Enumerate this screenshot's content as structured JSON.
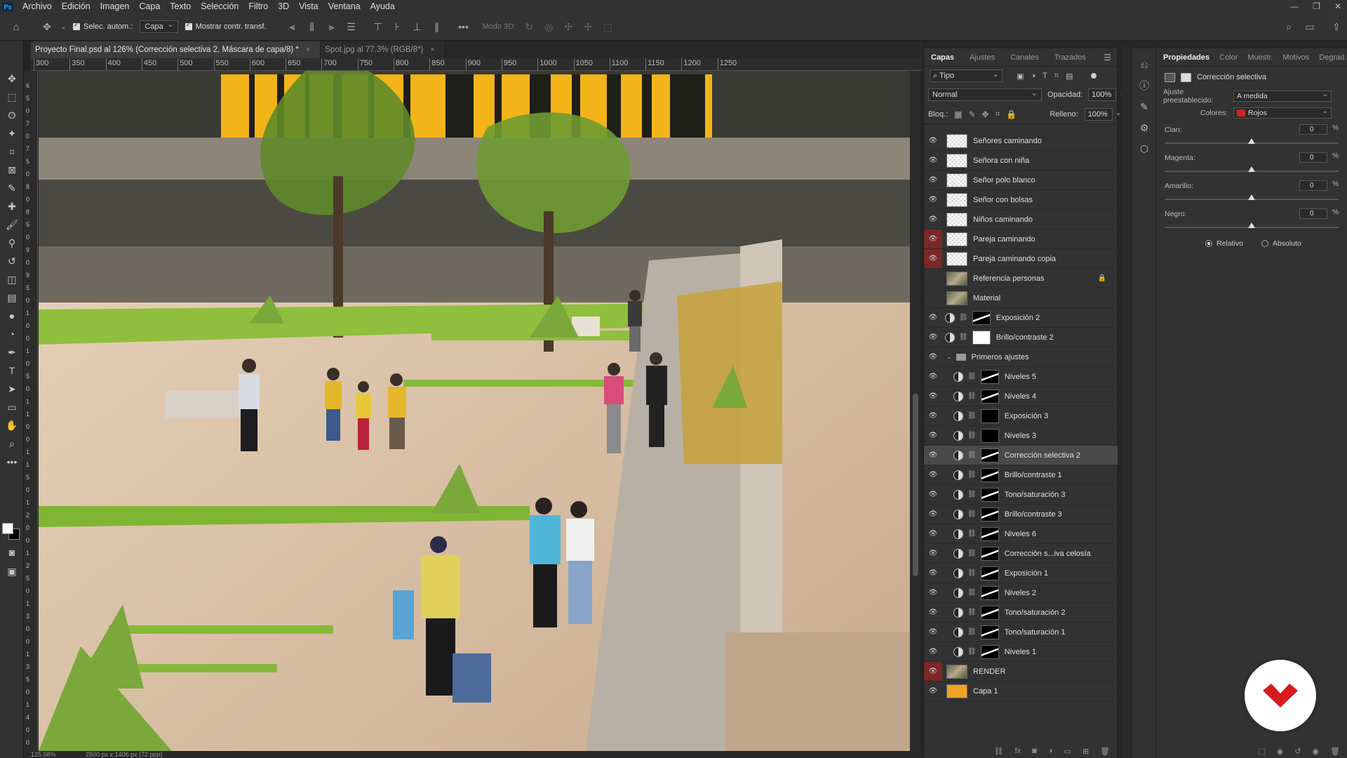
{
  "menubar": {
    "logo": "Ps",
    "items": [
      "Archivo",
      "Edición",
      "Imagen",
      "Capa",
      "Texto",
      "Selección",
      "Filtro",
      "3D",
      "Vista",
      "Ventana",
      "Ayuda"
    ]
  },
  "options": {
    "auto_select_label": "Selec. autom.:",
    "auto_select_target": "Capa",
    "show_transform_label": "Mostrar contr. transf.",
    "mode3d_label": "Modo 3D:"
  },
  "doc_tabs": [
    {
      "label": "Proyecto Final.psd al 126% (Corrección selectiva 2, Máscara de capa/8) *",
      "active": true
    },
    {
      "label": "Spot.jpg al 77.3% (RGB/8*)",
      "active": false
    }
  ],
  "ruler_top": [
    "300",
    "350",
    "400",
    "450",
    "500",
    "550",
    "600",
    "650",
    "700",
    "750",
    "800",
    "850",
    "900",
    "950",
    "1000",
    "1050",
    "1100",
    "1150",
    "1200",
    "1250"
  ],
  "ruler_left": [
    "6",
    "5",
    "0",
    "7",
    "0",
    "7",
    "5",
    "0",
    "8",
    "0",
    "8",
    "5",
    "0",
    "9",
    "0",
    "9",
    "5",
    "0",
    "1",
    "0",
    "0",
    "1",
    "0",
    "5",
    "0",
    "1",
    "1",
    "0",
    "0",
    "1",
    "1",
    "5",
    "0",
    "1",
    "2",
    "0",
    "0",
    "1",
    "2",
    "5",
    "0",
    "1",
    "3",
    "0",
    "0",
    "1",
    "3",
    "5",
    "0",
    "1",
    "4",
    "0",
    "0"
  ],
  "status": {
    "zoom": "125.58%",
    "doc_info": "2500 px x 1406 px (72 ppp)"
  },
  "layers_panel": {
    "tabs": [
      "Capas",
      "Ajustes",
      "Canales",
      "Trazados"
    ],
    "filter_label": "Tipo",
    "blend_mode": "Normal",
    "opacity_label": "Opacidad:",
    "opacity_value": "100%",
    "lock_label": "Bloq.:",
    "fill_label": "Relleno:",
    "fill_value": "100%",
    "layers": [
      {
        "name": "Señores caminando",
        "thumb": "checker",
        "eye": "on",
        "kind": "pixel"
      },
      {
        "name": "Señora con niña",
        "thumb": "checker",
        "eye": "on",
        "kind": "pixel"
      },
      {
        "name": "Señor polo blanco",
        "thumb": "checker",
        "eye": "on",
        "kind": "pixel"
      },
      {
        "name": "Señor con bolsas",
        "thumb": "checker",
        "eye": "on",
        "kind": "pixel"
      },
      {
        "name": "Niños caminando",
        "thumb": "checker",
        "eye": "on",
        "kind": "pixel"
      },
      {
        "name": "Pareja caminando",
        "thumb": "checker",
        "eye": "red",
        "kind": "pixel"
      },
      {
        "name": "Pareja caminando copia",
        "thumb": "checker",
        "eye": "red",
        "kind": "pixel"
      },
      {
        "name": "Referencia personas",
        "thumb": "photo",
        "eye": "off",
        "kind": "pixel",
        "locked": true
      },
      {
        "name": "Material",
        "thumb": "photo",
        "eye": "off",
        "kind": "pixel"
      },
      {
        "name": "Exposición 2",
        "thumb": "mask-mixed",
        "eye": "on",
        "kind": "adj"
      },
      {
        "name": "Brillo/contraste 2",
        "thumb": "mask-white",
        "eye": "on",
        "kind": "adj"
      },
      {
        "name": "Primeros ajustes",
        "eye": "on",
        "kind": "group"
      },
      {
        "name": "Niveles 5",
        "thumb": "mask-mixed",
        "eye": "on",
        "kind": "adj",
        "indent": true
      },
      {
        "name": "Niveles 4",
        "thumb": "mask-mixed",
        "eye": "on",
        "kind": "adj",
        "indent": true
      },
      {
        "name": "Exposición 3",
        "thumb": "mask-black",
        "eye": "on",
        "kind": "adj",
        "indent": true
      },
      {
        "name": "Niveles 3",
        "thumb": "mask-black",
        "eye": "on",
        "kind": "adj",
        "indent": true
      },
      {
        "name": "Corrección selectiva 2",
        "thumb": "mask-mixed",
        "eye": "on",
        "kind": "adj",
        "indent": true,
        "selected": true
      },
      {
        "name": "Brillo/contraste 1",
        "thumb": "mask-mixed",
        "eye": "on",
        "kind": "adj",
        "indent": true
      },
      {
        "name": "Tono/saturación 3",
        "thumb": "mask-mixed",
        "eye": "on",
        "kind": "adj",
        "indent": true
      },
      {
        "name": "Brillo/contraste 3",
        "thumb": "mask-mixed",
        "eye": "on",
        "kind": "adj",
        "indent": true
      },
      {
        "name": "Niveles 6",
        "thumb": "mask-mixed",
        "eye": "on",
        "kind": "adj",
        "indent": true
      },
      {
        "name": "Corrección s...iva celosía",
        "thumb": "mask-mixed",
        "eye": "on",
        "kind": "adj",
        "indent": true
      },
      {
        "name": "Exposición 1",
        "thumb": "mask-mixed",
        "eye": "on",
        "kind": "adj",
        "indent": true
      },
      {
        "name": "Niveles 2",
        "thumb": "mask-mixed",
        "eye": "on",
        "kind": "adj",
        "indent": true
      },
      {
        "name": "Tono/saturación 2",
        "thumb": "mask-mixed",
        "eye": "on",
        "kind": "adj",
        "indent": true
      },
      {
        "name": "Tono/saturación 1",
        "thumb": "mask-mixed",
        "eye": "on",
        "kind": "adj",
        "indent": true
      },
      {
        "name": "Niveles 1",
        "thumb": "mask-mixed",
        "eye": "on",
        "kind": "adj",
        "indent": true
      },
      {
        "name": "RENDER",
        "thumb": "photo",
        "eye": "red",
        "kind": "pixel"
      },
      {
        "name": "Capa 1",
        "thumb": "orange",
        "eye": "on",
        "kind": "pixel"
      }
    ]
  },
  "properties_panel": {
    "tabs": [
      "Propiedades",
      "Color",
      "Muestr.",
      "Motivos",
      "Degrad."
    ],
    "header": "Corrección selectiva",
    "preset_label": "Ajuste preestablecido:",
    "preset_value": "A medida",
    "colors_label": "Colores:",
    "colors_value": "Rojos",
    "colors_chip": "#d32222",
    "sliders": [
      {
        "label": "Cian:",
        "value": "0",
        "pct": "%",
        "level": 50
      },
      {
        "label": "Magenta:",
        "value": "0",
        "pct": "%",
        "level": 50
      },
      {
        "label": "Amarillo:",
        "value": "0",
        "pct": "%",
        "level": 50
      },
      {
        "label": "Negro:",
        "value": "0",
        "pct": "%",
        "level": 50
      }
    ],
    "mode_relative": "Relativo",
    "mode_absolute": "Absoluto"
  }
}
